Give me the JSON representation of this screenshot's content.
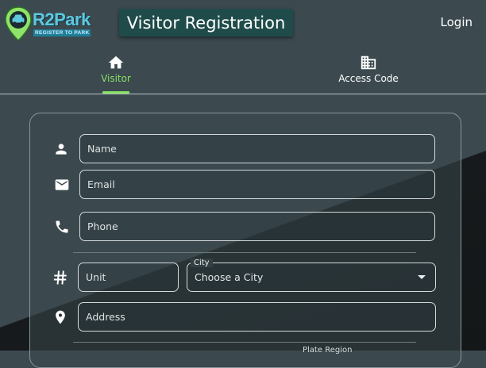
{
  "header": {
    "logo_text": "R2Park",
    "logo_tagline": "REGISTER TO PARK",
    "title": "Visitor Registration",
    "login_label": "Login"
  },
  "tabs": [
    {
      "label": "Visitor",
      "icon": "home-icon",
      "active": true
    },
    {
      "label": "Access Code",
      "icon": "building-icon",
      "active": false
    }
  ],
  "form": {
    "name_placeholder": "Name",
    "email_placeholder": "Email",
    "phone_placeholder": "Phone",
    "unit_placeholder": "Unit",
    "city_label": "City",
    "city_value": "Choose a City",
    "address_placeholder": "Address",
    "cut_off_label": "Plate Region"
  },
  "colors": {
    "accent_green": "#86df63",
    "title_bg": "#1f4c4a",
    "background": "#3c4a50",
    "logo_blue": "#5ec8df"
  }
}
